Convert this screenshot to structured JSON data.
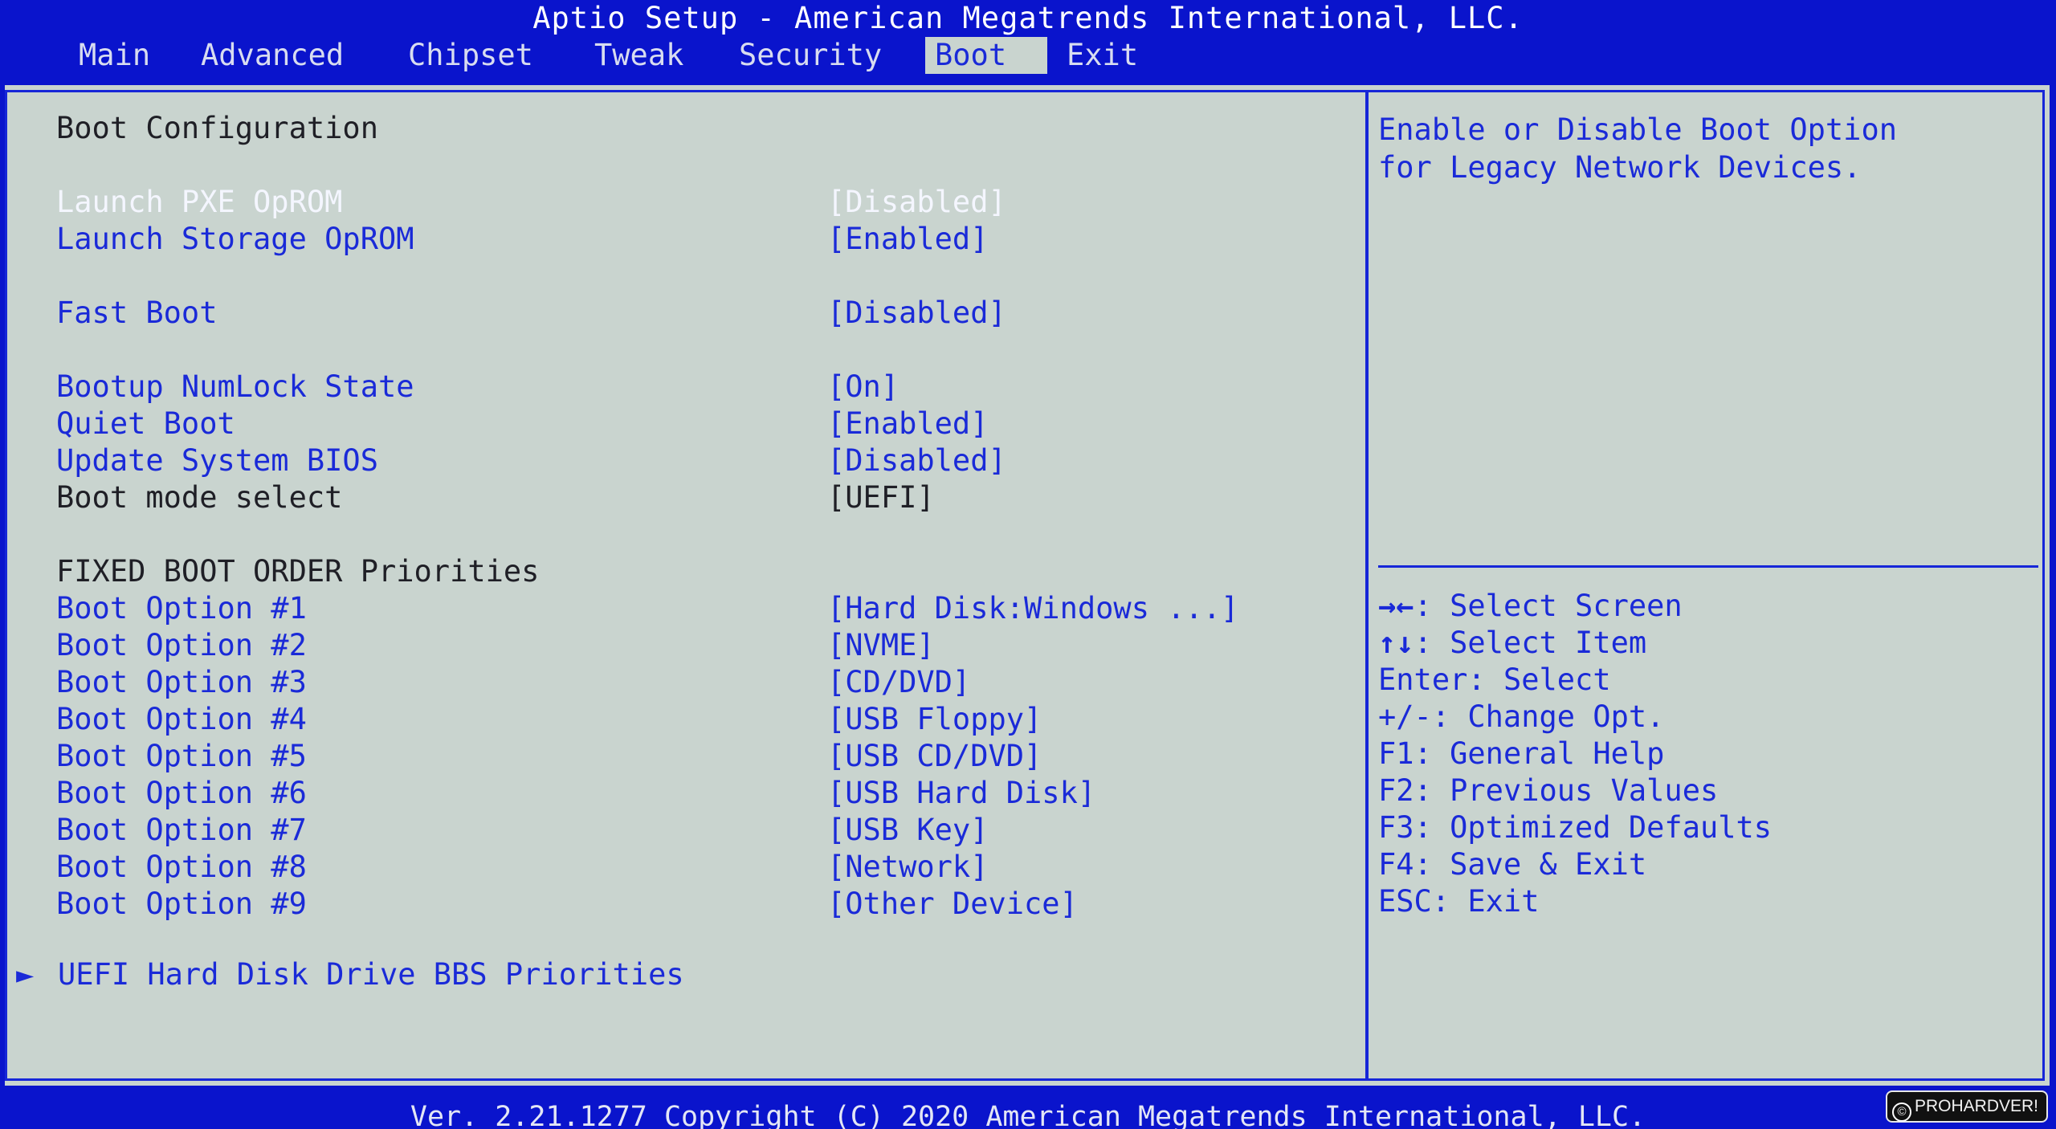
{
  "window": {
    "title": "Aptio Setup - American Megatrends International, LLC."
  },
  "tabs": [
    {
      "label": "Main"
    },
    {
      "label": "Advanced"
    },
    {
      "label": "Chipset"
    },
    {
      "label": "Tweak"
    },
    {
      "label": "Security"
    },
    {
      "label": "Boot",
      "active": true
    },
    {
      "label": "Exit"
    }
  ],
  "main": {
    "section_title": "Boot Configuration",
    "rows": [
      {
        "label": "Launch PXE OpROM",
        "value": "[Disabled]",
        "selected": true
      },
      {
        "label": "Launch Storage OpROM",
        "value": "[Enabled]"
      },
      {
        "label": "Fast Boot",
        "value": "[Disabled]"
      },
      {
        "label": "Bootup NumLock State",
        "value": "[On]"
      },
      {
        "label": "Quiet Boot",
        "value": "[Enabled]"
      },
      {
        "label": "Update System BIOS",
        "value": "[Disabled]"
      },
      {
        "label": "Boot mode select",
        "value": "[UEFI]",
        "static": true
      }
    ],
    "priorities_title": "FIXED BOOT ORDER Priorities",
    "boot_options": [
      {
        "label": "Boot Option #1",
        "value": "[Hard Disk:Windows ...]"
      },
      {
        "label": "Boot Option #2",
        "value": "[NVME]"
      },
      {
        "label": "Boot Option #3",
        "value": "[CD/DVD]"
      },
      {
        "label": "Boot Option #4",
        "value": "[USB Floppy]"
      },
      {
        "label": "Boot Option #5",
        "value": "[USB CD/DVD]"
      },
      {
        "label": "Boot Option #6",
        "value": "[USB Hard Disk]"
      },
      {
        "label": "Boot Option #7",
        "value": "[USB Key]"
      },
      {
        "label": "Boot Option #8",
        "value": "[Network]"
      },
      {
        "label": "Boot Option #9",
        "value": "[Other Device]"
      }
    ],
    "submenu": {
      "arrow": "►",
      "label": "UEFI Hard Disk Drive BBS Priorities"
    }
  },
  "help": {
    "line1": "Enable or Disable Boot Option",
    "line2": "for Legacy Network Devices."
  },
  "keys": [
    {
      "key": "→←",
      "text": ": Select Screen"
    },
    {
      "key": "↑↓",
      "text": ": Select Item"
    },
    {
      "key": "Enter",
      "text": ": Select"
    },
    {
      "key": "+/-",
      "text": ": Change Opt."
    },
    {
      "key": "F1",
      "text": ": General Help"
    },
    {
      "key": "F2",
      "text": ": Previous Values"
    },
    {
      "key": "F3",
      "text": ": Optimized Defaults"
    },
    {
      "key": "F4",
      "text": ": Save & Exit"
    },
    {
      "key": "ESC",
      "text": ": Exit"
    }
  ],
  "footer": "Ver. 2.21.1277 Copyright (C) 2020 American Megatrends International, LLC.",
  "watermark": {
    "symbol": "©",
    "text": "PROHARDVER!"
  }
}
